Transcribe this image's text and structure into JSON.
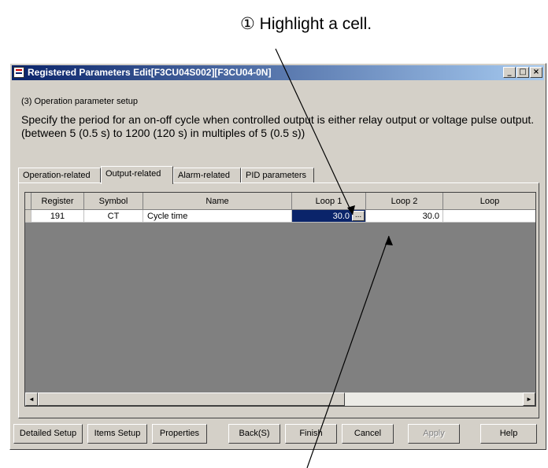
{
  "annotation": "① Highlight a cell.",
  "window": {
    "title": "Registered Parameters Edit[F3CU04S002][F3CU04-0N]",
    "buttons": [
      "_",
      "□",
      "×"
    ]
  },
  "section_title": "(3) Operation parameter setup",
  "description": "Specify the period for an on-off cycle when controlled output is either relay output or voltage pulse output. (between 5 (0.5 s) to 1200 (120 s) in multiples of 5 (0.5 s))",
  "tabs": [
    {
      "label": "Operation-related",
      "active": false
    },
    {
      "label": "Output-related",
      "active": true
    },
    {
      "label": "Alarm-related",
      "active": false
    },
    {
      "label": "PID parameters",
      "active": false
    }
  ],
  "grid": {
    "columns": [
      "Register",
      "Symbol",
      "Name",
      "Loop 1",
      "Loop 2",
      "Loop"
    ],
    "rows": [
      {
        "register": "191",
        "symbol": "CT",
        "name": "Cycle time",
        "loop1": "30.0",
        "loop2": "30.0",
        "loop3": ""
      }
    ],
    "ellipsis": "..."
  },
  "scroll_arrows": {
    "left": "◄",
    "right": "►"
  },
  "buttons": {
    "detailed_setup": "Detailed Setup",
    "items_setup": "Items Setup",
    "properties": "Properties",
    "back": "Back(S)",
    "finish": "Finish",
    "cancel": "Cancel",
    "apply": "Apply",
    "help": "Help"
  },
  "colors": {
    "selection": "#0a246a",
    "face": "#d4d0c8",
    "grid_background": "#808080"
  }
}
